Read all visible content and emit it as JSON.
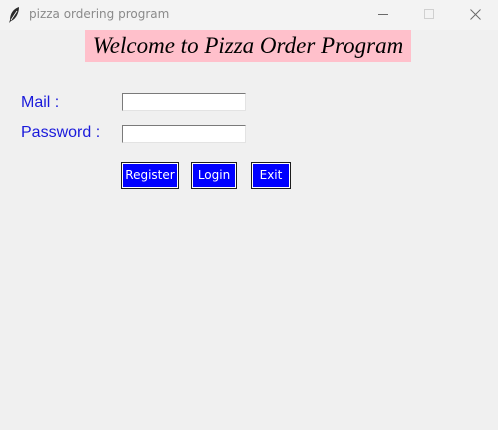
{
  "window": {
    "title": "pizza ordering program",
    "icon": "feather-icon",
    "controls": [
      "minimize-icon",
      "maximize-icon",
      "close-icon"
    ]
  },
  "banner": {
    "text": "Welcome to Pizza Order Program",
    "background": "#ffc0cb"
  },
  "form": {
    "mail_label": "Mail :",
    "mail_value": "",
    "password_label": "Password :",
    "password_value": "",
    "label_color": "#1a1adb"
  },
  "buttons": {
    "register": "Register",
    "login": "Login",
    "exit": "Exit",
    "background": "#0000ff",
    "text_color": "#ffffff"
  }
}
